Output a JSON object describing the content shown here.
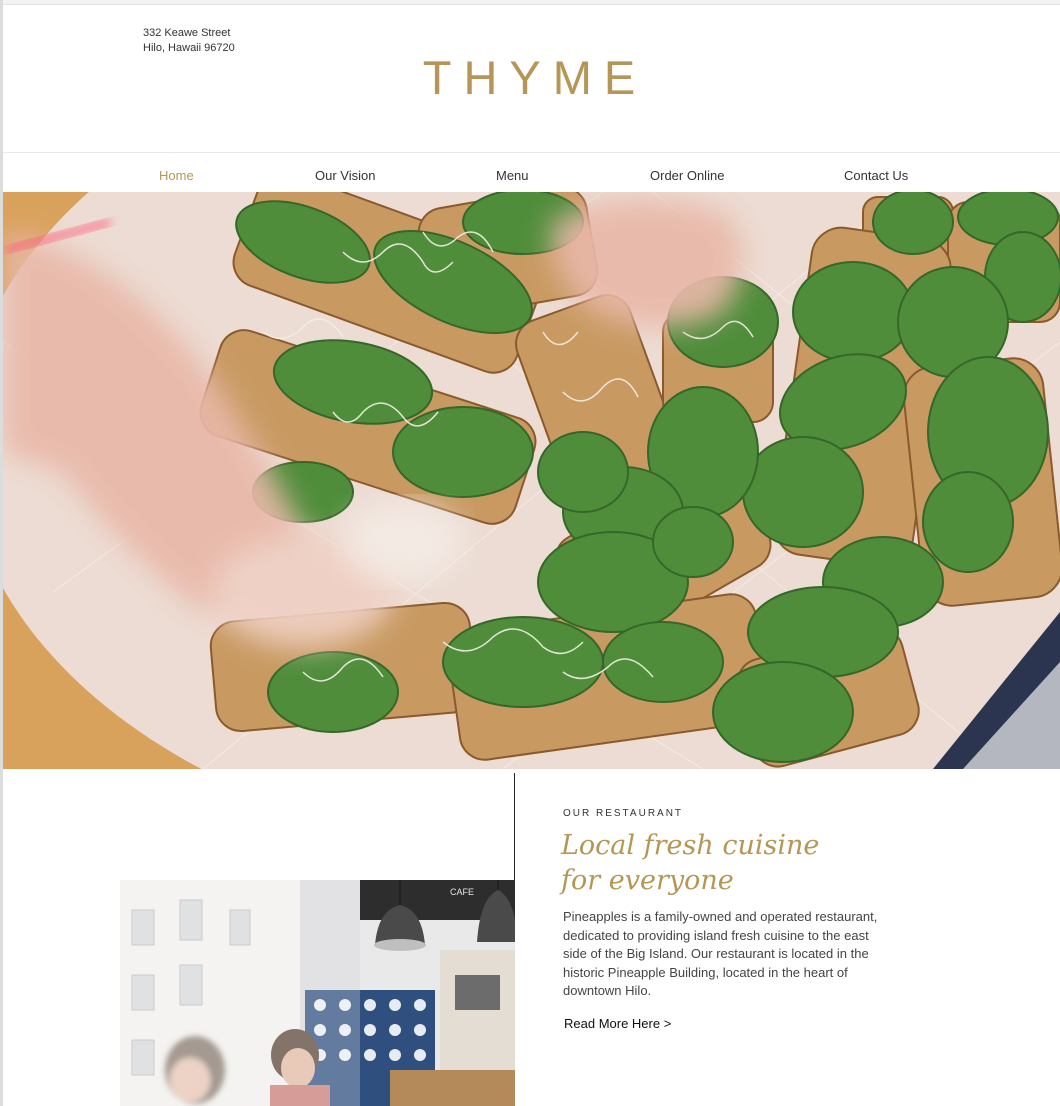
{
  "header": {
    "address_line1": "332 Keawe Street",
    "address_line2": "Hilo, Hawaii 96720",
    "logo": "THYME"
  },
  "nav": {
    "items": [
      {
        "label": "Home",
        "active": true
      },
      {
        "label": "Our Vision",
        "active": false
      },
      {
        "label": "Menu",
        "active": false
      },
      {
        "label": "Order Online",
        "active": false
      },
      {
        "label": "Contact Us",
        "active": false
      }
    ]
  },
  "hero": {
    "image": "toast with spinach and sprouts on a plate"
  },
  "restaurant": {
    "kicker": "OUR RESTAURANT",
    "headline_line1": "Local fresh cuisine",
    "headline_line2": "for everyone",
    "body": "Pineapples is a family-owned and operated restaurant, dedicated to providing island fresh cuisine to the east side of the Big Island. Our restaurant is located in the historic Pineapple Building, located in the heart of downtown Hilo.",
    "read_more": "Read More Here >",
    "image": "restaurant interior with pendant lamps"
  },
  "colors": {
    "accent": "#b59656",
    "text": "#333333"
  }
}
